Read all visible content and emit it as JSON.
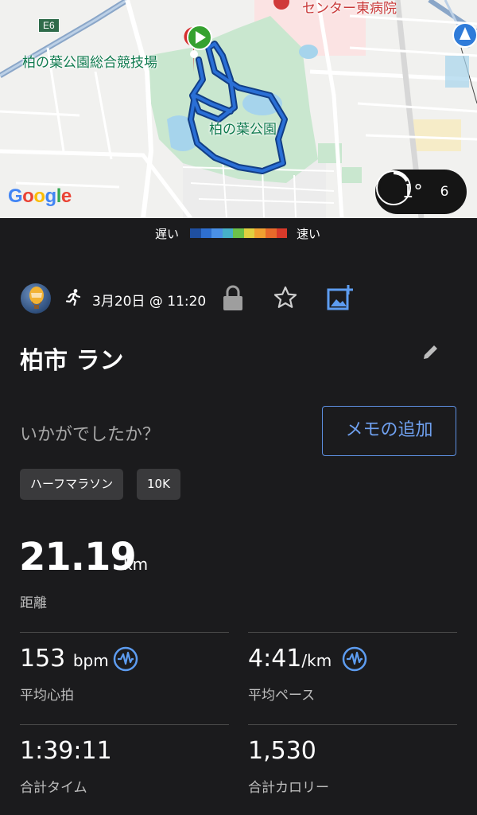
{
  "map": {
    "highway_shield": "E6",
    "labels": {
      "stadium": "柏の葉公園総合競技場",
      "park": "柏の葉公園",
      "hospital": "センター東病院"
    },
    "logo": "Google",
    "weather": {
      "temperature": "11°",
      "uv_index": "6"
    }
  },
  "speed_legend": {
    "slow": "遅い",
    "fast": "速い",
    "colors": [
      "#1f4fa0",
      "#2e6fd0",
      "#4a90e6",
      "#46b0c8",
      "#6cc24a",
      "#e0d040",
      "#f0a030",
      "#e86a2a",
      "#d83a2a"
    ]
  },
  "activity": {
    "type_icon": "running-icon",
    "date": "3月20日 @ 11:20",
    "title": "柏市 ラン",
    "feedback_prompt": "いかがでしたか？",
    "add_note_label": "メモの追加",
    "tags": [
      "ハーフマラソン",
      "10K"
    ]
  },
  "stats": {
    "distance": {
      "value": "21.19",
      "unit": "km",
      "label": "距離"
    },
    "avg_hr": {
      "value": "153",
      "unit": "bpm",
      "label": "平均心拍"
    },
    "avg_pace": {
      "value": "4:41",
      "unit": "/km",
      "label": "平均ペース"
    },
    "total_time": {
      "value": "1:39:11",
      "label": "合計タイム"
    },
    "total_calories": {
      "value": "1,530",
      "label": "合計カロリー"
    }
  },
  "colors": {
    "background": "#1b1b1d",
    "accent": "#6fa0ef",
    "route": "#1e5fc4"
  }
}
